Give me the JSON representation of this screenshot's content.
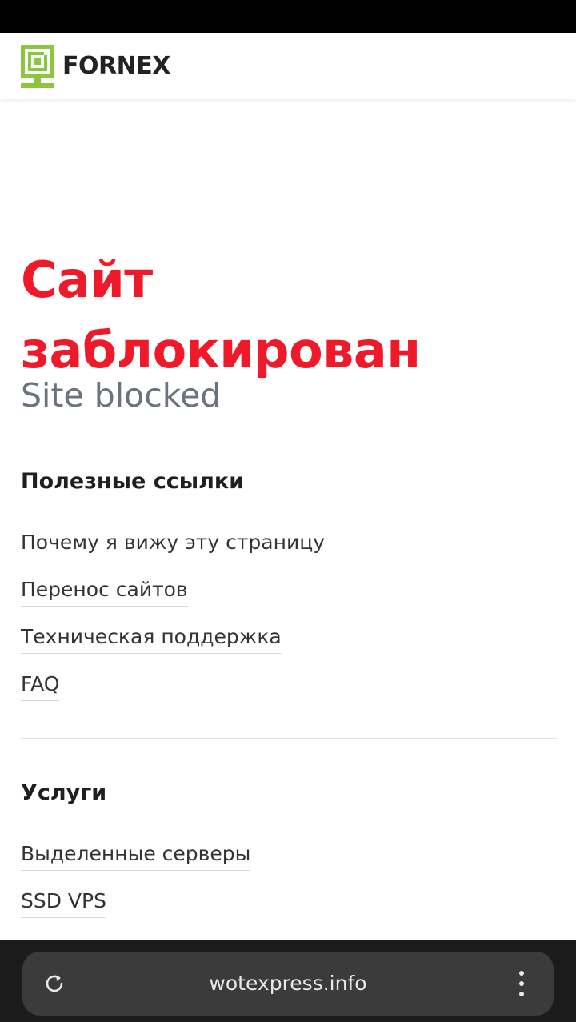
{
  "header": {
    "logo_text": "FORNEX"
  },
  "main": {
    "title_line1": "Сайт",
    "title_line2": "заблокирован",
    "subtitle": "Site blocked",
    "useful_links": {
      "heading": "Полезные ссылки",
      "items": [
        {
          "label": "Почему я вижу эту страницу"
        },
        {
          "label": "Перенос сайтов"
        },
        {
          "label": "Техническая поддержка"
        },
        {
          "label": "FAQ"
        }
      ]
    },
    "services": {
      "heading": "Услуги",
      "items": [
        {
          "label": "Выделенные серверы"
        },
        {
          "label": "SSD VPS"
        }
      ]
    }
  },
  "browser": {
    "url": "wotexpress.info",
    "reload_icon": "reload-icon",
    "menu_icon": "more-vert-icon"
  },
  "colors": {
    "accent_red": "#ee1a2a",
    "logo_green": "#8cc63f",
    "subtitle_gray": "#6b7280"
  }
}
